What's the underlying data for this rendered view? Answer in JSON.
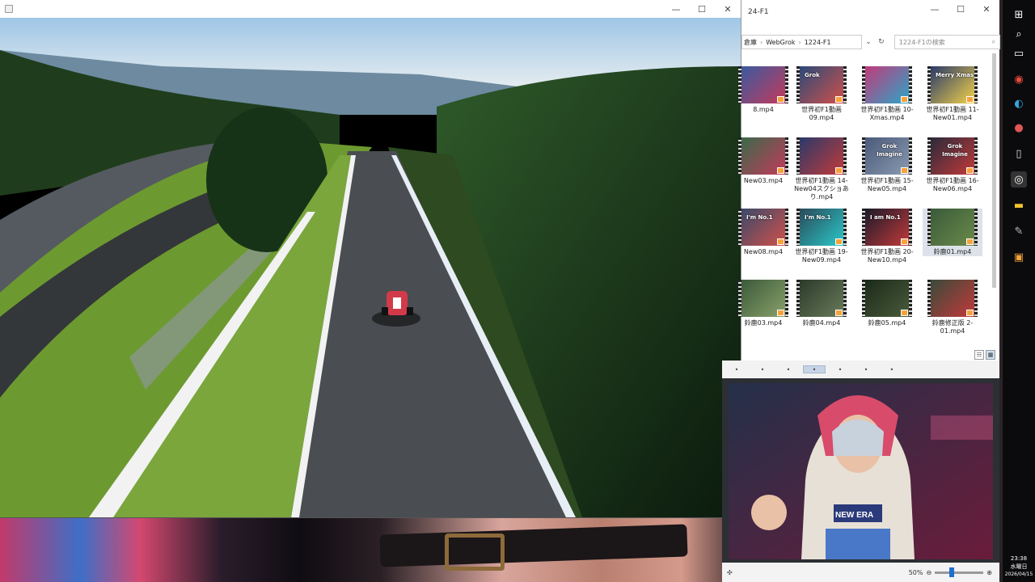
{
  "video_player": {
    "title": "",
    "window_controls": [
      "—",
      "☐",
      "✕"
    ]
  },
  "explorer": {
    "title": "24-F1",
    "window_controls": [
      "—",
      "☐",
      "✕"
    ],
    "address": [
      "倉庫",
      "WebGrok",
      "1224-F1"
    ],
    "search_placeholder": "1224-F1の検索",
    "files": [
      {
        "label": "8.mp4",
        "overlay": ""
      },
      {
        "label": "世界初F1動画 09.mp4",
        "overlay": "Grok"
      },
      {
        "label": "世界初F1動画 10-Xmas.mp4",
        "overlay": ""
      },
      {
        "label": "世界初F1動画 11-New01.mp4",
        "overlay": "Merry Xmas"
      },
      {
        "label": "New03.mp4",
        "overlay": ""
      },
      {
        "label": "世界初F1動画 14-New04スクショあり.mp4",
        "overlay": ""
      },
      {
        "label": "世界初F1動画 15-New05.mp4",
        "overlay": "Grok Imagine"
      },
      {
        "label": "世界初F1動画 16-New06.mp4",
        "overlay": "Grok Imagine"
      },
      {
        "label": "New08.mp4",
        "overlay": "I'm No.1"
      },
      {
        "label": "世界初F1動画 19-New09.mp4",
        "overlay": "I'm No.1"
      },
      {
        "label": "世界初F1動画 20-New10.mp4",
        "overlay": "I am No.1"
      },
      {
        "label": "鈴鹿01.mp4",
        "overlay": ""
      },
      {
        "label": "鈴鹿03.mp4",
        "overlay": ""
      },
      {
        "label": "鈴鹿04.mp4",
        "overlay": ""
      },
      {
        "label": "鈴鹿05.mp4",
        "overlay": ""
      },
      {
        "label": "鈴鹿修正版 2-01.mp4",
        "overlay": ""
      }
    ]
  },
  "viewer": {
    "zoom": "50%",
    "zoom_fraction": 0.5
  },
  "taskbar": {
    "time": "23:38",
    "day": "水曜日",
    "date": "2026/04/15"
  }
}
